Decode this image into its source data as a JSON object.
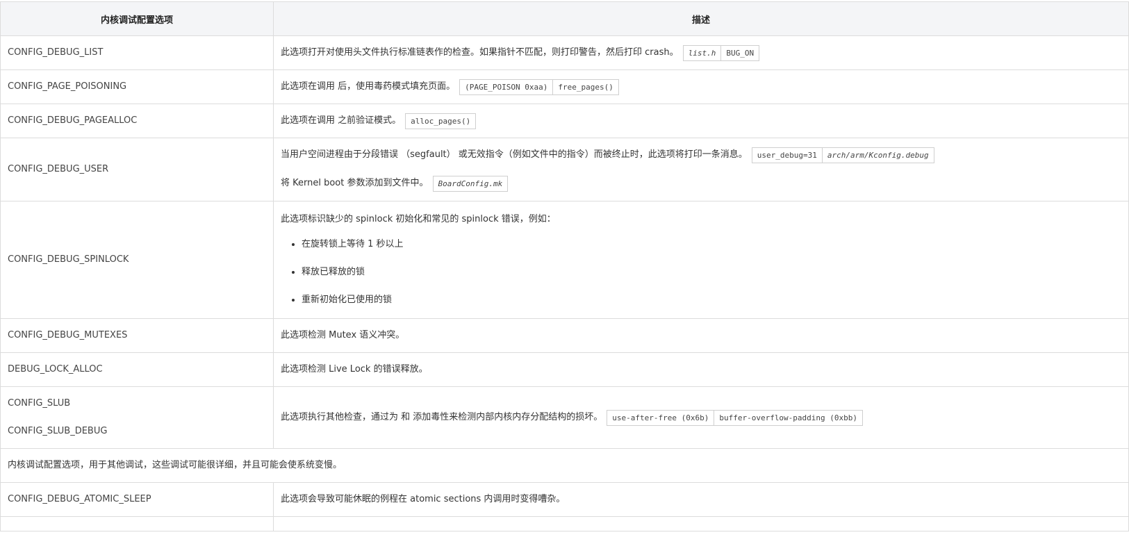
{
  "table": {
    "headers": [
      "内核调试配置选项",
      "描述"
    ],
    "rows": {
      "r0": {
        "option": "CONFIG_DEBUG_LIST",
        "desc": "此选项打开对使用头文件执行标准链表作的检查。如果指针不匹配，则打印警告，然后打印 crash。",
        "codes": [
          "list.h",
          "BUG_ON"
        ]
      },
      "r1": {
        "option": "CONFIG_PAGE_POISONING",
        "desc": "此选项在调用 后，使用毒药模式填充页面。",
        "codes": [
          "(PAGE_POISON 0xaa)",
          "free_pages()"
        ]
      },
      "r2": {
        "option": "CONFIG_DEBUG_PAGEALLOC",
        "desc": "此选项在调用 之前验证模式。",
        "codes": [
          "alloc_pages()"
        ]
      },
      "r3": {
        "option": "CONFIG_DEBUG_USER",
        "desc1": "当用户空间进程由于分段错误 （segfault） 或无效指令（例如文件中的指令）而被终止时，此选项将打印一条消息。",
        "codes1": [
          "user_debug=31",
          "arch/arm/Kconfig.debug"
        ],
        "desc2": "将 Kernel boot 参数添加到文件中。",
        "codes2": [
          "BoardConfig.mk"
        ]
      },
      "r4": {
        "option": "CONFIG_DEBUG_SPINLOCK",
        "desc": "此选项标识缺少的 spinlock 初始化和常见的 spinlock 错误，例如：",
        "items": [
          "在旋转锁上等待 1 秒以上",
          "释放已释放的锁",
          "重新初始化已使用的锁"
        ]
      },
      "r5": {
        "option": "CONFIG_DEBUG_MUTEXES",
        "desc": "此选项检测 Mutex 语义冲突。"
      },
      "r6": {
        "option": "DEBUG_LOCK_ALLOC",
        "desc": "此选项检测 Live Lock 的错误释放。"
      },
      "r7": {
        "option1": "CONFIG_SLUB",
        "option2": "CONFIG_SLUB_DEBUG",
        "desc": "此选项执行其他检查，通过为 和 添加毒性来检测内部内核内存分配结构的损坏。",
        "codes": [
          "use-after-free (0x6b)",
          "buffer-overflow-padding (0xbb)"
        ]
      },
      "r8": {
        "span": "内核调试配置选项，用于其他调试，这些调试可能很详细，并且可能会使系统变慢。"
      },
      "r9": {
        "option": "CONFIG_DEBUG_ATOMIC_SLEEP",
        "desc": "此选项会导致可能休眠的例程在 atomic sections 内调用时变得嘈杂。"
      }
    }
  }
}
